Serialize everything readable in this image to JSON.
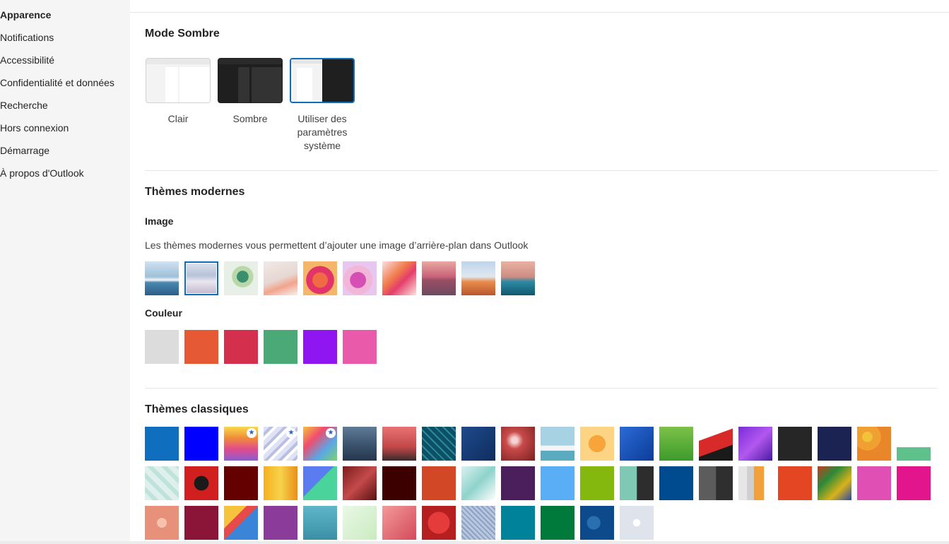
{
  "sidebar": {
    "items": [
      {
        "label": "Apparence",
        "active": true
      },
      {
        "label": "Notifications"
      },
      {
        "label": "Accessibilité"
      },
      {
        "label": "Confidentialité et données"
      },
      {
        "label": "Recherche"
      },
      {
        "label": "Hors connexion"
      },
      {
        "label": "Démarrage"
      },
      {
        "label": "À propos d'Outlook"
      }
    ]
  },
  "dark_mode": {
    "title": "Mode Sombre",
    "options": [
      {
        "label": "Clair"
      },
      {
        "label": "Sombre"
      },
      {
        "label": "Utiliser des paramètres système",
        "selected": true
      }
    ]
  },
  "modern_themes": {
    "title": "Thèmes modernes",
    "image_heading": "Image",
    "description": "Les thèmes modernes vous permettent d’ajouter une image d’arrière-plan dans Outlook",
    "image_selected_index": 1,
    "color_heading": "Couleur",
    "colors": [
      "#dcdcdc",
      "#e55a34",
      "#d4304d",
      "#4ba877",
      "#8f16f0",
      "#ea5aaa"
    ]
  },
  "classic_themes": {
    "title": "Thèmes classiques",
    "starred_indices": [
      2,
      3,
      4
    ]
  }
}
